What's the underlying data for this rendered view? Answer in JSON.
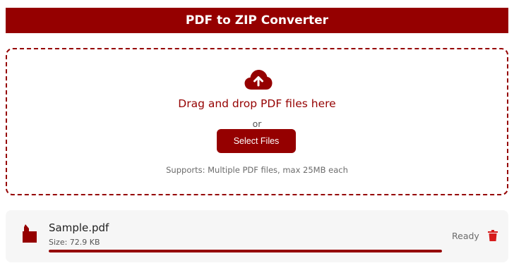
{
  "header": {
    "title": "PDF to ZIP Converter"
  },
  "dropzone": {
    "icon": "cloud-upload-icon",
    "title": "Drag and drop PDF files here",
    "or_text": "or",
    "select_label": "Select Files",
    "supports_text": "Supports: Multiple PDF files, max 25MB each"
  },
  "file": {
    "icon": "pdf-file-icon",
    "name": "Sample.pdf",
    "size": "Size: 72.9 KB",
    "progress_percent": 100,
    "status": "Ready",
    "delete_icon": "trash-icon"
  },
  "colors": {
    "accent": "#950000",
    "card_background": "#f6f6f6",
    "delete": "#d61c1c"
  }
}
